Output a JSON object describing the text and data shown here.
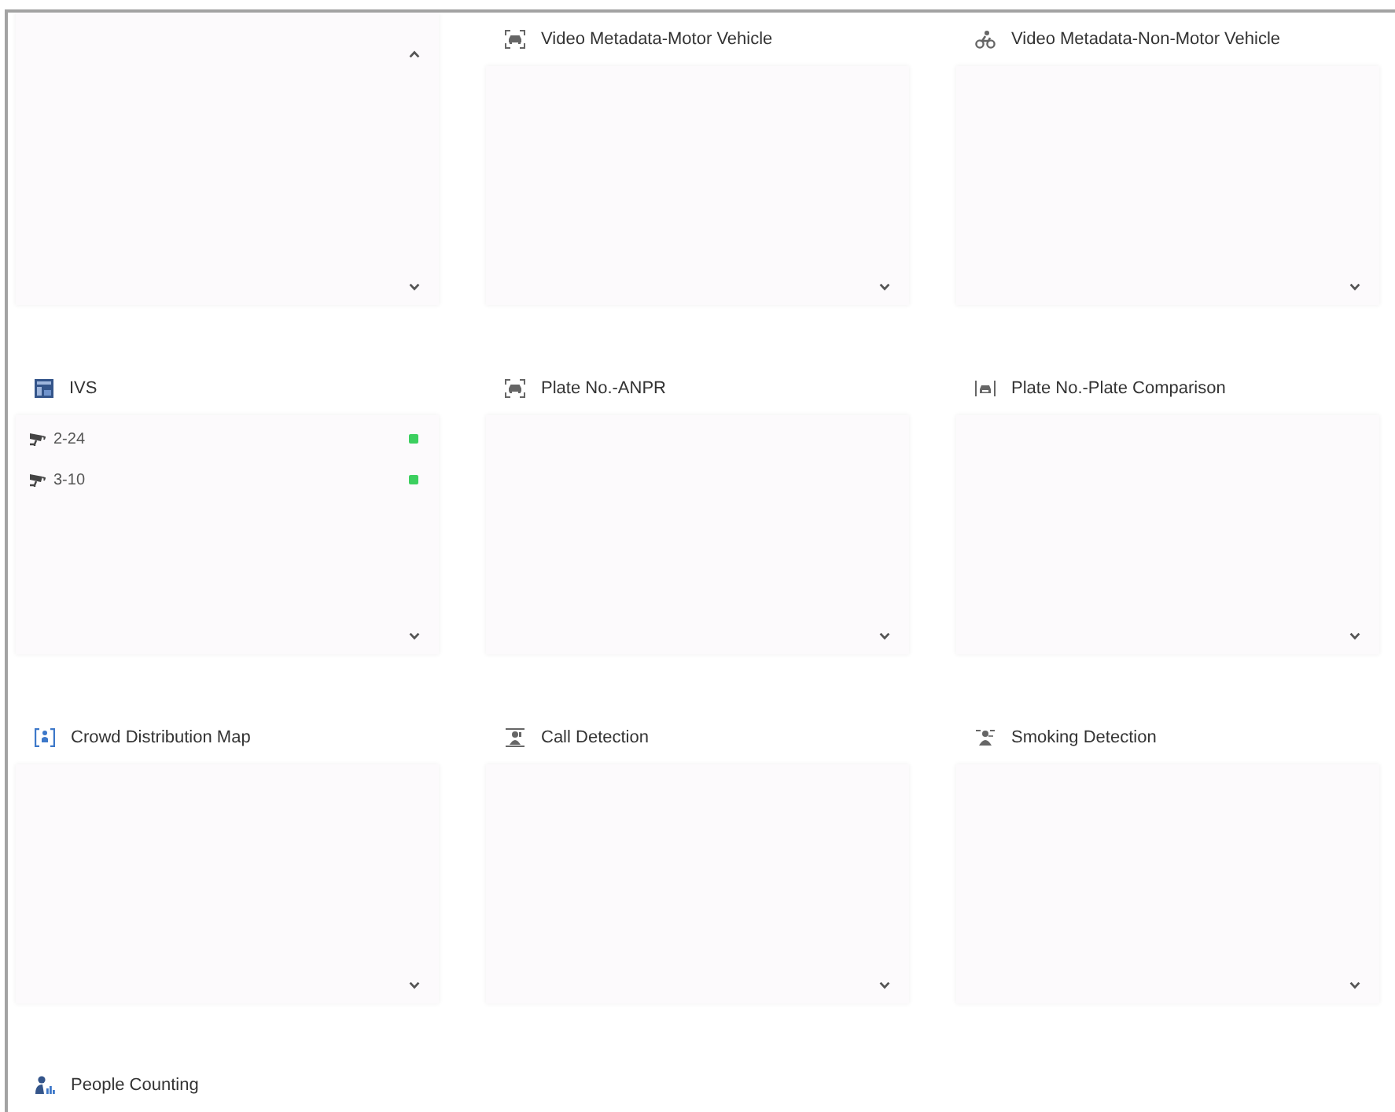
{
  "cards": [
    {
      "kind": "list",
      "scroll_up": true,
      "scroll_down": true
    },
    {
      "kind": "titled",
      "title": "Video Metadata-Motor Vehicle",
      "scroll_up": false,
      "scroll_down": true
    },
    {
      "kind": "titled",
      "title": "Video Metadata-Non-Motor Vehicle",
      "scroll_up": false,
      "scroll_down": true
    },
    {
      "kind": "titled",
      "title": "IVS",
      "items": [
        {
          "label": "2-24",
          "color": "#3ccf5f"
        },
        {
          "label": "3-10",
          "color": "#3ccf5f"
        }
      ],
      "scroll_up": false,
      "scroll_down": true
    },
    {
      "kind": "titled",
      "title": "Plate No.-ANPR",
      "scroll_up": false,
      "scroll_down": true
    },
    {
      "kind": "titled",
      "title": "Plate No.-Plate Comparison",
      "scroll_up": false,
      "scroll_down": true
    },
    {
      "kind": "titled",
      "title": "Crowd Distribution Map",
      "scroll_up": false,
      "scroll_down": true
    },
    {
      "kind": "titled",
      "title": "Call Detection",
      "scroll_up": false,
      "scroll_down": true
    },
    {
      "kind": "titled",
      "title": "Smoking Detection",
      "scroll_up": false,
      "scroll_down": true
    },
    {
      "kind": "heading",
      "title": "People Counting"
    }
  ]
}
